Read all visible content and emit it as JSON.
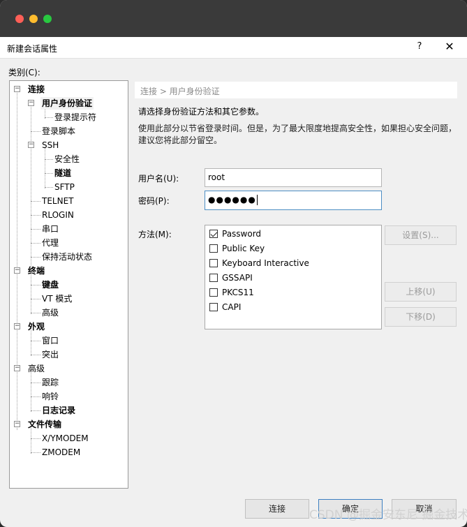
{
  "window": {
    "title": "新建会话属性",
    "help": "?",
    "close": "✕"
  },
  "category_label": "类别(C):",
  "tree": [
    {
      "label": "连接",
      "bold": true
    },
    {
      "label": "用户身份验证",
      "bold": true,
      "selected": true
    },
    {
      "label": "登录提示符",
      "bold": false
    },
    {
      "label": "登录脚本",
      "bold": false
    },
    {
      "label": "SSH",
      "bold": false
    },
    {
      "label": "安全性",
      "bold": false
    },
    {
      "label": "隧道",
      "bold": true
    },
    {
      "label": "SFTP",
      "bold": false
    },
    {
      "label": "TELNET",
      "bold": false
    },
    {
      "label": "RLOGIN",
      "bold": false
    },
    {
      "label": "串口",
      "bold": false
    },
    {
      "label": "代理",
      "bold": false
    },
    {
      "label": "保持活动状态",
      "bold": false
    },
    {
      "label": "终端",
      "bold": true
    },
    {
      "label": "键盘",
      "bold": true
    },
    {
      "label": "VT 模式",
      "bold": false
    },
    {
      "label": "高级",
      "bold": false
    },
    {
      "label": "外观",
      "bold": true
    },
    {
      "label": "窗口",
      "bold": false
    },
    {
      "label": "突出",
      "bold": false
    },
    {
      "label": "高级",
      "bold": false
    },
    {
      "label": "跟踪",
      "bold": false
    },
    {
      "label": "响铃",
      "bold": false
    },
    {
      "label": "日志记录",
      "bold": true
    },
    {
      "label": "文件传输",
      "bold": true
    },
    {
      "label": "X/YMODEM",
      "bold": false
    },
    {
      "label": "ZMODEM",
      "bold": false
    }
  ],
  "breadcrumb": "连接 > 用户身份验证",
  "intro": "请选择身份验证方法和其它参数。",
  "note_line1": "使用此部分以节省登录时间。但是，为了最大限度地提高安全性，如果担心安全问题，",
  "note_line2": "建议您将此部分留空。",
  "username": {
    "label": "用户名(U):",
    "value": "root"
  },
  "password": {
    "label": "密码(P):",
    "value": "●●●●●●"
  },
  "method": {
    "label": "方法(M):",
    "options": [
      {
        "label": "Password",
        "checked": true
      },
      {
        "label": "Public Key",
        "checked": false
      },
      {
        "label": "Keyboard Interactive",
        "checked": false
      },
      {
        "label": "GSSAPI",
        "checked": false
      },
      {
        "label": "PKCS11",
        "checked": false
      },
      {
        "label": "CAPI",
        "checked": false
      }
    ]
  },
  "buttons": {
    "settings": "设置(S)...",
    "move_up": "上移(U)",
    "move_down": "下移(D)",
    "connect": "连接",
    "ok": "确定",
    "cancel": "取消"
  },
  "watermark": "CSDN @掘金安东尼 掘金技术社区"
}
